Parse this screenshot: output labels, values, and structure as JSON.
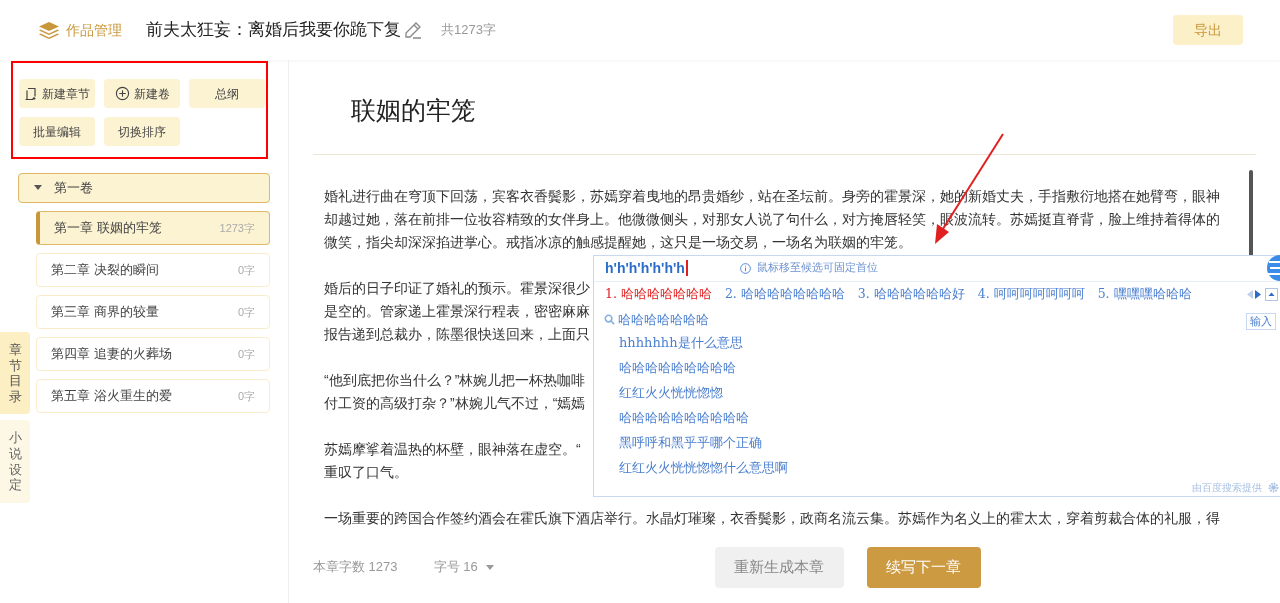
{
  "header": {
    "brand": "作品管理",
    "book_title": "前夫太狂妄：离婚后我要你跪下复",
    "word_total": "共1273字",
    "export_button": "导出"
  },
  "toolbar": [
    {
      "label": "新建章节"
    },
    {
      "label": "新建卷"
    },
    {
      "label": "总纲"
    },
    {
      "label": "批量编辑"
    },
    {
      "label": "切换排序"
    }
  ],
  "side_tabs": [
    {
      "label": "章节目录",
      "selected": true
    },
    {
      "label": "小说设定",
      "selected": false
    }
  ],
  "volumes": [
    {
      "label": "第一卷",
      "expanded": true,
      "chapters": [
        {
          "title": "第一章 联姻的牢笼",
          "count": "1273字",
          "selected": true
        },
        {
          "title": "第二章 决裂的瞬间",
          "count": "0字",
          "selected": false
        },
        {
          "title": "第三章 商界的较量",
          "count": "0字",
          "selected": false
        },
        {
          "title": "第四章 追妻的火葬场",
          "count": "0字",
          "selected": false
        },
        {
          "title": "第五章 浴火重生的爱",
          "count": "0字",
          "selected": false
        }
      ]
    }
  ],
  "editor": {
    "chapter_title": "联姻的牢笼",
    "paragraphs": [
      [
        "婚礼进行曲在穹顶下回荡，宾客衣香鬓影，苏嫣穿着曳地的昂贵婚纱，站在圣坛前。身旁的霍景深，她的新婚丈夫，手指敷衍地搭在她臂弯，眼神",
        "却越过她，落在前排一位妆容精致的女伴身上。他微微侧头，对那女人说了句什么，对方掩唇轻笑，眼波流转。苏嫣挺直脊背，脸上维持着得体的",
        "微笑，指尖却深深掐进掌心。戒指冰凉的触感提醒她，这只是一场交易，一场名为联姻的牢笼。"
      ],
      [
        "婚后的日子印证了婚礼的预示。霍景深很少",
        "是空的。管家递上霍景深行程表，密密麻麻",
        "报告递到总裁办，陈墨很快送回来，上面只"
      ],
      [
        "“他到底把你当什么？”林婉儿把一杯热咖啡",
        "付工资的高级打杂？”林婉儿气不过，“嫣嫣"
      ],
      [
        "苏嫣摩挲着温热的杯壁，眼神落在虚空。“",
        "重叹了口气。"
      ],
      [
        "一场重要的跨国合作签约酒会在霍氏旗下酒店举行。水晶灯璀璨，衣香鬓影，政商名流云集。苏嫣作为名义上的霍太太，穿着剪裁合体的礼服，得"
      ]
    ],
    "chapter_count": "本章字数 1273",
    "font_size": "字号 16",
    "regenerate_button": "重新生成本章",
    "continue_button": "续写下一章"
  },
  "ime_popup": {
    "input": "h'h'h'h'h'h'h",
    "hint": "鼠标移至候选可固定首位",
    "candidates": [
      {
        "label": "1. 哈哈哈哈哈哈哈",
        "selected": true
      },
      {
        "label": "2. 哈哈哈哈哈哈哈哈",
        "selected": false
      },
      {
        "label": "3. 哈哈哈哈哈哈好",
        "selected": false
      },
      {
        "label": "4. 呵呵呵呵呵呵呵",
        "selected": false
      },
      {
        "label": "5. 嘿嘿嘿哈哈哈",
        "selected": false
      }
    ],
    "search_query": "哈哈哈哈哈哈哈",
    "enter_button": "输入",
    "suggestions": [
      "hhhhhhh是什么意思",
      "哈哈哈哈哈哈哈哈哈",
      "红红火火恍恍惚惚",
      "哈哈哈哈哈哈哈哈哈哈",
      "黑呼呼和黑乎乎哪个正确",
      "红红火火恍恍惚惚什么意思啊"
    ],
    "footer": "由百度搜索提供"
  }
}
